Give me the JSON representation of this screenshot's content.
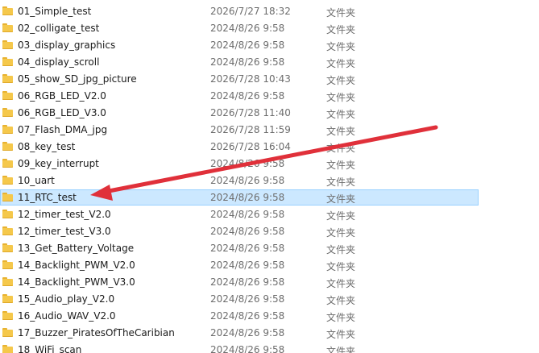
{
  "files": [
    {
      "name": "01_Simple_test",
      "date": "2026/7/27 18:32",
      "type": "文件夹"
    },
    {
      "name": "02_colligate_test",
      "date": "2024/8/26 9:58",
      "type": "文件夹"
    },
    {
      "name": "03_display_graphics",
      "date": "2024/8/26 9:58",
      "type": "文件夹"
    },
    {
      "name": "04_display_scroll",
      "date": "2024/8/26 9:58",
      "type": "文件夹"
    },
    {
      "name": "05_show_SD_jpg_picture",
      "date": "2026/7/28 10:43",
      "type": "文件夹"
    },
    {
      "name": "06_RGB_LED_V2.0",
      "date": "2024/8/26 9:58",
      "type": "文件夹"
    },
    {
      "name": "06_RGB_LED_V3.0",
      "date": "2026/7/28 11:40",
      "type": "文件夹"
    },
    {
      "name": "07_Flash_DMA_jpg",
      "date": "2026/7/28 11:59",
      "type": "文件夹"
    },
    {
      "name": "08_key_test",
      "date": "2026/7/28 16:04",
      "type": "文件夹"
    },
    {
      "name": "09_key_interrupt",
      "date": "2024/8/26 9:58",
      "type": "文件夹"
    },
    {
      "name": "10_uart",
      "date": "2024/8/26 9:58",
      "type": "文件夹"
    },
    {
      "name": "11_RTC_test",
      "date": "2024/8/26 9:58",
      "type": "文件夹",
      "selected": true
    },
    {
      "name": "12_timer_test_V2.0",
      "date": "2024/8/26 9:58",
      "type": "文件夹"
    },
    {
      "name": "12_timer_test_V3.0",
      "date": "2024/8/26 9:58",
      "type": "文件夹"
    },
    {
      "name": "13_Get_Battery_Voltage",
      "date": "2024/8/26 9:58",
      "type": "文件夹"
    },
    {
      "name": "14_Backlight_PWM_V2.0",
      "date": "2024/8/26 9:58",
      "type": "文件夹"
    },
    {
      "name": "14_Backlight_PWM_V3.0",
      "date": "2024/8/26 9:58",
      "type": "文件夹"
    },
    {
      "name": "15_Audio_play_V2.0",
      "date": "2024/8/26 9:58",
      "type": "文件夹"
    },
    {
      "name": "16_Audio_WAV_V2.0",
      "date": "2024/8/26 9:58",
      "type": "文件夹"
    },
    {
      "name": "17_Buzzer_PiratesOfTheCaribian",
      "date": "2024/8/26 9:58",
      "type": "文件夹"
    },
    {
      "name": "18_WiFi_scan",
      "date": "2024/8/26 9:58",
      "type": "文件夹"
    }
  ],
  "annotation": {
    "arrow_color": "#e0303a",
    "points_to": "11_RTC_test"
  },
  "colors": {
    "selection_bg": "#cce8ff",
    "selection_border": "#99d1ff",
    "folder": "#f5c84b"
  }
}
